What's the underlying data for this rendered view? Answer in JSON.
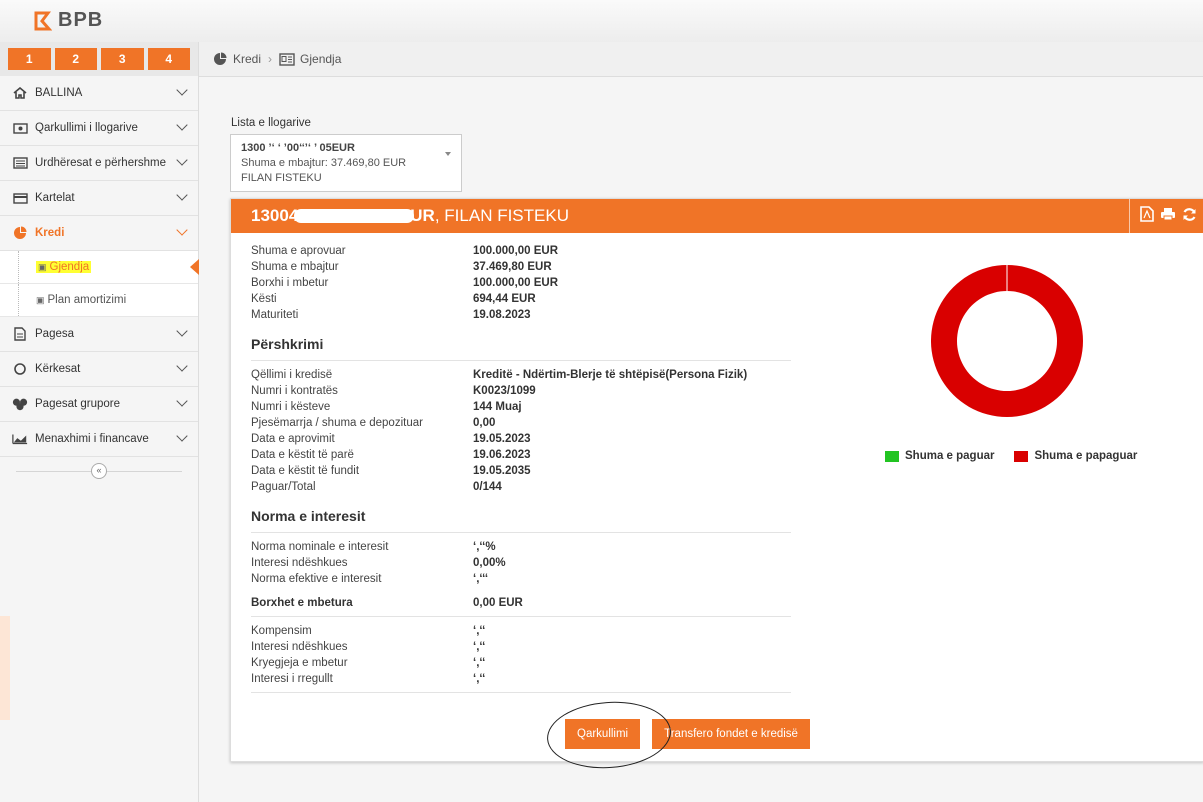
{
  "brand": {
    "name": "BPB"
  },
  "colors": {
    "accent": "#f07427",
    "paid": "#22c422",
    "unpaid": "#d90000",
    "highlight": "#ffff33"
  },
  "tabs": [
    "1",
    "2",
    "3",
    "4"
  ],
  "sidebar": {
    "items": [
      {
        "label": "BALLINA",
        "icon": "home-icon"
      },
      {
        "label": "Qarkullimi i llogarive",
        "icon": "money-icon"
      },
      {
        "label": "Urdhëresat e përhershme",
        "icon": "list-icon"
      },
      {
        "label": "Kartelat",
        "icon": "card-icon"
      },
      {
        "label": "Kredi",
        "icon": "pie-icon"
      },
      {
        "label": "Pagesa",
        "icon": "document-icon"
      },
      {
        "label": "Kërkesat",
        "icon": "circle-icon"
      },
      {
        "label": "Pagesat grupore",
        "icon": "group-icon"
      },
      {
        "label": "Menaxhimi i financave",
        "icon": "chart-icon"
      }
    ],
    "subitems": [
      {
        "label": "Gjendja"
      },
      {
        "label": "Plan amortizimi"
      }
    ],
    "collapse_glyph": "«"
  },
  "breadcrumb": {
    "parent": "Kredi",
    "sep": "›",
    "current": "Gjendja"
  },
  "account": {
    "label": "Lista e llogarive",
    "number": "1300 ’‘ ‘ ’00‘‘’‘ ’ 05EUR",
    "held": "Shuma e mbajtur: 37.469,80 EUR",
    "owner": "FILAN FISTEKU"
  },
  "panel": {
    "title_prefix": "13004",
    "title_suffix": "UR",
    "title_owner": ", FILAN FISTEKU"
  },
  "summary": [
    {
      "label": "Shuma e aprovuar",
      "value": "100.000,00 EUR"
    },
    {
      "label": "Shuma e mbajtur",
      "value": "37.469,80 EUR"
    },
    {
      "label": "Borxhi i mbetur",
      "value": "100.000,00 EUR"
    },
    {
      "label": "Kësti",
      "value": "694,44 EUR"
    },
    {
      "label": "Maturiteti",
      "value": "19.08.2023"
    }
  ],
  "description": {
    "title": "Përshkrimi",
    "rows": [
      {
        "label": "Qëllimi i kredisë",
        "value": "Kreditë - Ndërtim-Blerje të shtëpisë(Persona Fizik)"
      },
      {
        "label": "Numri i kontratës",
        "value": "K0023/1099"
      },
      {
        "label": "Numri i kësteve",
        "value": "144 Muaj"
      },
      {
        "label": "Pjesëmarrja / shuma e depozituar",
        "value": "0,00"
      },
      {
        "label": "Data e aprovimit",
        "value": "19.05.2023"
      },
      {
        "label": "Data e këstit të parë",
        "value": "19.06.2023"
      },
      {
        "label": "Data e këstit të fundit",
        "value": "19.05.2035"
      },
      {
        "label": "Paguar/Total",
        "value": "0/144"
      }
    ]
  },
  "interest": {
    "title": "Norma e interesit",
    "rows": [
      {
        "label": "Norma nominale e interesit",
        "value": "‘,‘‘%"
      },
      {
        "label": "Interesi ndëshkues",
        "value": "0,00%"
      },
      {
        "label": "Norma efektive e interesit",
        "value": "‘,‘‘‘"
      }
    ],
    "debts_label": "Borxhet e mbetura",
    "debts_value": "0,00 EUR",
    "debt_rows": [
      {
        "label": "Kompensim",
        "value": "‘,‘‘"
      },
      {
        "label": "Interesi ndëshkues",
        "value": "‘,‘‘"
      },
      {
        "label": "Kryegjeja e mbetur",
        "value": "‘,‘‘"
      },
      {
        "label": "Interesi i rregullt",
        "value": "‘,‘‘"
      }
    ]
  },
  "buttons": {
    "turnover": "Qarkullimi",
    "transfer": "Transfero fondet e kredisë"
  },
  "chart_data": {
    "type": "pie",
    "categories": [
      "Shuma e paguar",
      "Shuma e papaguar"
    ],
    "values": [
      0,
      100
    ],
    "legend": "bottom"
  }
}
